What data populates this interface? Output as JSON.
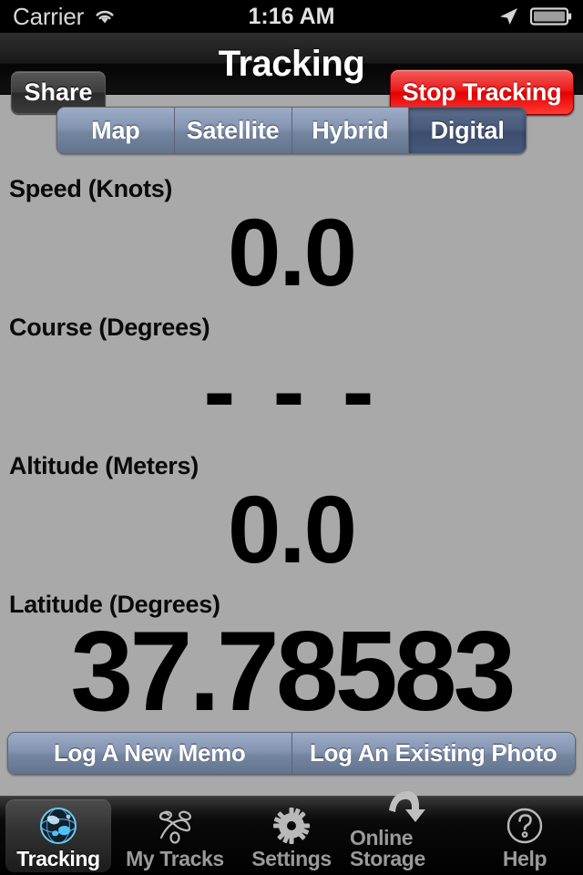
{
  "status_bar": {
    "carrier": "Carrier",
    "wifi_icon": "wifi-icon",
    "time": "1:16 AM",
    "location_icon": "location-arrow-icon",
    "battery_icon": "battery-icon"
  },
  "nav_bar": {
    "title": "Tracking",
    "share_label": "Share",
    "stop_tracking_label": "Stop Tracking",
    "stop_tracking_color": "#e40000"
  },
  "map_modes": {
    "segments": [
      {
        "label": "Map",
        "selected": false
      },
      {
        "label": "Satellite",
        "selected": false
      },
      {
        "label": "Hybrid",
        "selected": false
      },
      {
        "label": "Digital",
        "selected": true
      }
    ],
    "selected_color": "#46587a",
    "unselected_color": "#8394b2"
  },
  "readouts": [
    {
      "label": "Speed (Knots)",
      "value": "0.0"
    },
    {
      "label": "Course (Degrees)",
      "value": "- - -"
    },
    {
      "label": "Altitude (Meters)",
      "value": "0.0"
    },
    {
      "label": "Latitude (Degrees)",
      "value": "37.78583"
    }
  ],
  "log_buttons": {
    "new_memo_label": "Log A New Memo",
    "existing_photo_label": "Log An Existing Photo"
  },
  "tab_bar": {
    "items": [
      {
        "label": "Tracking",
        "icon": "globe-icon",
        "selected": true
      },
      {
        "label": "My Tracks",
        "icon": "track-loop-icon",
        "selected": false
      },
      {
        "label": "Settings",
        "icon": "gear-icon",
        "selected": false
      },
      {
        "label": "Online Storage",
        "icon": "download-arrow-icon",
        "selected": false
      },
      {
        "label": "Help",
        "icon": "question-circle-icon",
        "selected": false
      }
    ]
  }
}
